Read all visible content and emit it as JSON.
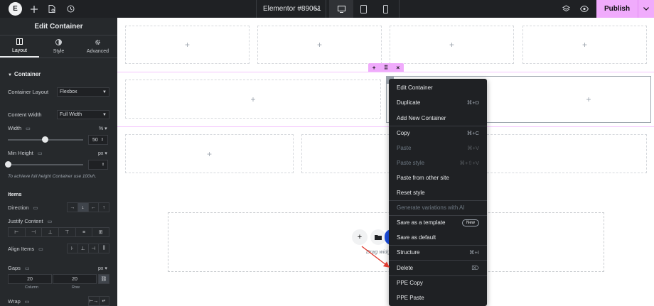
{
  "topbar": {
    "logo": "E",
    "document_title": "Elementor #89061",
    "publish_label": "Publish",
    "icons": [
      "plus-icon",
      "document-settings-icon",
      "history-icon"
    ],
    "devices": [
      "desktop-icon",
      "tablet-icon",
      "mobile-icon"
    ],
    "right_icons": [
      "layers-icon",
      "preview-eye-icon"
    ]
  },
  "panel": {
    "title": "Edit Container",
    "tabs": [
      {
        "label": "Layout",
        "icon": "layout-icon",
        "active": true
      },
      {
        "label": "Style",
        "icon": "style-icon",
        "active": false
      },
      {
        "label": "Advanced",
        "icon": "gear-icon",
        "active": false
      }
    ],
    "section_container": "Container",
    "container_layout_label": "Container Layout",
    "container_layout_value": "Flexbox",
    "content_width_label": "Content Width",
    "content_width_value": "Full Width",
    "width_label": "Width",
    "width_unit": "%",
    "width_value": "50",
    "width_fraction": 0.5,
    "min_height_label": "Min Height",
    "min_height_unit": "px",
    "min_height_value": "",
    "hint": "To achieve full height Container use 100vh.",
    "section_items": "Items",
    "direction_label": "Direction",
    "direction_buttons": [
      "→",
      "↓",
      "←",
      "↑"
    ],
    "justify_label": "Justify Content",
    "justify_buttons": [
      "⊢",
      "⊣",
      "⊥",
      "⊤",
      "≡",
      "⊞"
    ],
    "align_label": "Align Items",
    "align_buttons": [
      "⊦",
      "⊥",
      "⊣",
      "⫼"
    ],
    "gaps_label": "Gaps",
    "gaps_unit": "px",
    "gap_column": "20",
    "gap_row": "20",
    "gap_column_label": "Column",
    "gap_row_label": "Row",
    "wrap_label": "Wrap",
    "wrap_buttons": [
      "⊢→",
      "↵"
    ]
  },
  "canvas": {
    "plus": "+",
    "drag_text": "Drag widg"
  },
  "context_menu": {
    "items": [
      {
        "label": "Edit Container",
        "shortcut": "",
        "disabled": false
      },
      {
        "label": "Duplicate",
        "shortcut": "⌘+D",
        "disabled": false
      },
      {
        "label": "Add New Container",
        "shortcut": "",
        "disabled": false
      },
      {
        "label": "Copy",
        "shortcut": "⌘+C",
        "disabled": false
      },
      {
        "label": "Paste",
        "shortcut": "⌘+V",
        "disabled": true
      },
      {
        "label": "Paste style",
        "shortcut": "⌘+⇧+V",
        "disabled": true
      },
      {
        "label": "Paste from other site",
        "shortcut": "",
        "disabled": false
      },
      {
        "label": "Reset style",
        "shortcut": "",
        "disabled": false
      },
      {
        "label": "Generate variations with AI",
        "shortcut": "",
        "disabled": true
      },
      {
        "label": "Save as a template",
        "shortcut": "",
        "badge": "New",
        "disabled": false
      },
      {
        "label": "Save as default",
        "shortcut": "",
        "disabled": false
      },
      {
        "label": "Structure",
        "shortcut": "⌘+I",
        "disabled": false
      },
      {
        "label": "Delete",
        "shortcut": "⌦",
        "disabled": false
      },
      {
        "label": "PPE Copy",
        "shortcut": "",
        "disabled": false
      },
      {
        "label": "PPE Paste",
        "shortcut": "",
        "disabled": false
      }
    ]
  },
  "colors": {
    "accent": "#f0abfc",
    "panel_bg": "#26292c",
    "topbar_bg": "#1f2124",
    "annotation_arrow": "#e03a2f"
  }
}
